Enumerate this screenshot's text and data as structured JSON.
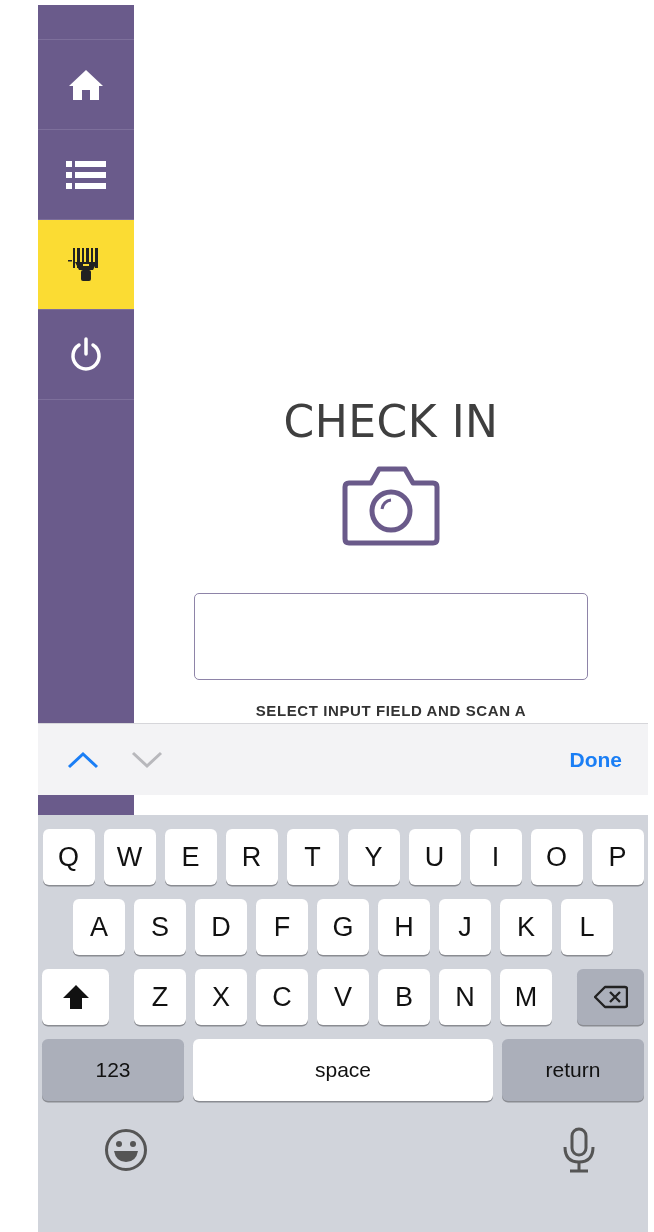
{
  "sidebar": {
    "items": [
      {
        "kind": "home",
        "selected": false
      },
      {
        "kind": "list",
        "selected": false
      },
      {
        "kind": "scanner",
        "selected": true
      },
      {
        "kind": "power",
        "selected": false
      }
    ]
  },
  "title": "CHECK IN",
  "hint": "SELECT INPUT FIELD AND SCAN A",
  "toolbar": {
    "previous_enabled": true,
    "next_enabled": false,
    "done": "Done"
  },
  "keyboard": {
    "letter_rows": [
      [
        "Q",
        "W",
        "E",
        "R",
        "T",
        "Y",
        "U",
        "I",
        "O",
        "P"
      ],
      [
        "A",
        "S",
        "D",
        "F",
        "G",
        "H",
        "J",
        "K",
        "L"
      ],
      [
        "Z",
        "X",
        "C",
        "V",
        "B",
        "N",
        "M"
      ]
    ],
    "numbers_key": "123",
    "space_key": "space",
    "return_key": "return"
  }
}
